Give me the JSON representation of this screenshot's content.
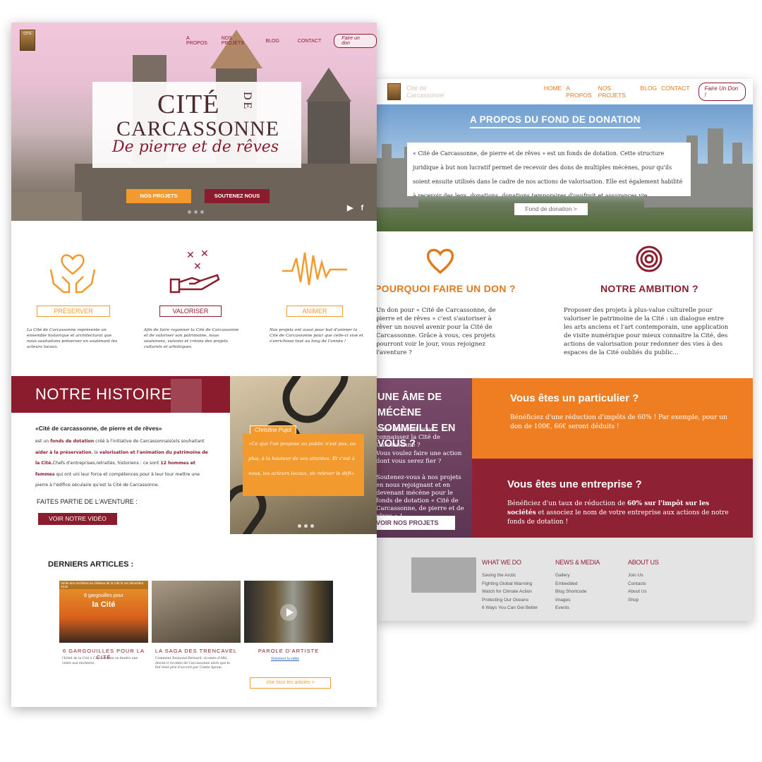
{
  "page1": {
    "nav": {
      "logo_text": "CITÉ",
      "items": [
        "A PROPOS",
        "NOS PROJETS",
        "BLOG",
        "CONTACT"
      ],
      "donate": "Faire un don"
    },
    "hero": {
      "title_cite": "CITÉ",
      "title_de": "DE",
      "title_carcassonne": "CARCASSONNE",
      "tagline": "De pierre et de rêves",
      "btn_projects": "NOS PROJETS",
      "btn_support": "SOUTENEZ NOUS",
      "social_youtube": "▶",
      "social_facebook": "f"
    },
    "pillars": [
      {
        "label": "PRÉSERVER",
        "text": "La Cité de Carcassonne représente un ensemble historique et architectural que nous souhaitons préserver en soutenant les acteurs locaux."
      },
      {
        "label": "VALORISER",
        "text": "Afin de faire rayonner la Cité de Carcassonne et de valoriser son patrimoine, nous soutenons, suivons et créons des projets culturels et artistiques."
      },
      {
        "label": "ANIMER",
        "text": "Nos projets ont aussi pour but d'animer la Cité de Carcassonne pour que celle-ci vive et s'enrichisse tout au long de l'année !"
      }
    ],
    "histoire": {
      "heading": "NOTRE HISTOIRE",
      "title": "«Cité de carcassonne, de pierre et de rêves»",
      "body_1": "est un ",
      "body_b1": "fonds de dotation",
      "body_2": " créé à l'initiative de Carcassonnais(e)s souhaitant ",
      "body_b2": "aider à la préservation",
      "body_3": ", la ",
      "body_b3": "valorisation et l'animation du patrimoine de la Cité.",
      "body_4": "Chefs d'entreprises,retraités, historiens : ce sont ",
      "body_b4": "12 hommes et femmes",
      "body_5": " qui ont uni leur force et compétences pour à leur tour mettre une pierre à l'édifice séculaire qu'est la Cité de Carcassonne.",
      "faites_partie": "FAITES PARTIE DE L'AVENTURE :",
      "video_button": "VOIR NOTRE VIDÉO",
      "quote_author": "Christine Pujol",
      "quote": "«Ce que l'on propose au public n'est pas, ou plus, à la hauteur de ses attentes. Et c'est à nous, les acteurs locaux, de relever le défi»."
    },
    "articles": {
      "heading": "DERNIERS ARTICLES :",
      "items": [
        {
          "title": "6 GARGOUILLES POUR LA CITÉ",
          "caption": "Vente aux enchères au château de la Cité le 1er décembre 2019",
          "overlay_1": "6 gargouilles pour",
          "overlay_2": "la Cité",
          "text": "l'hôtel de la Cité à Carcassonne se fendra une vente aux enchères."
        },
        {
          "title": "LA SAGA DES TRENCAVEL",
          "text": "Comment Raimond-Bernard, vicomte d'Albi, devint-il vicomte de Carcassonne alors que le fief était prié d'accord par Comte Ipsum."
        },
        {
          "title": "PAROLE D'ARTISTE",
          "link": "Visionnez la vidéo"
        }
      ],
      "see_all": "Voir tous les articles  >"
    }
  },
  "page2": {
    "nav": {
      "logo_text": "Cité de Carcassonne",
      "items": [
        "HOME",
        "A PROPOS",
        "NOS PROJETS",
        "BLOG",
        "CONTACT"
      ],
      "donate": "Faire Un Don !"
    },
    "hero": {
      "title": "A PROPOS DU FOND DE DONATION",
      "text": "« Cité de Carcassonne, de pierre et de rêves » est un fonds de dotation. Cette structure juridique à but non lucratif permet de recevoir des dons de multiples mécènes, pour qu'ils soient ensuite utilisés dans le cadre de nos actions de valorisation. Elle est également habilité à recevoir des legs, donations, donations temporaires d'usufruit et assurances vie.",
      "button": "Fond de donation  >"
    },
    "pourquoi": {
      "heading": "POURQUOI FAIRE UN DON ?",
      "text": "Un don pour « Cité de Carcassonne, de pierre et de rêves » c'est s'autoriser à rêver un nouvel avenir pour la Cité de Carcassonne. Grâce à vous, ces projets pourront voir le jour, vous rejoignez l'aventure ?"
    },
    "ambition": {
      "heading": "NOTRE AMBITION ?",
      "text": "Proposer des projets à plus-value culturelle pour valoriser le patrimoine de la Cité : un dialogue entre les arts anciens et l'art contemporain, une application de visite numérique pour mieux connaitre la Cité, des actions de valorisation pour redonner des vies à des espaces de la Cité oubliés du public..."
    },
    "mecene": {
      "heading_1": "UNE ÂME DE MÉCÈNE",
      "heading_2": "SOMMEILLE EN VOUS ?",
      "p1": "Vous aimez et vous connaissez la Cité de Carcassonne ?",
      "p2": "Vous voulez faire une action dont vous serez fier ?",
      "p3": "Soutenez-vous à nos projets en nous rejoignant et en devenant mécène pour le fonds de dotation « Cité de Carcassonne, de pierre et de rêves » !",
      "button": "VOIR NOS PROJETS"
    },
    "particulier": {
      "heading": "Vous êtes un particulier ?",
      "text": "Bénéficiez d'une réduction d'impôts de 60% ! Par exemple, pour un don de 100€, 66€ seront déduits !"
    },
    "entreprise": {
      "heading": "Vous êtes une entreprise ?",
      "text_1": "Bénéficiez d'un taux de réduction de ",
      "text_b1": "60% sur l'impôt sur les sociétés",
      "text_2": " et associez le nom de votre entreprise aux actions de notre fonds de dotation !"
    },
    "footer": {
      "col1": {
        "heading": "WHAT WE DO",
        "items": [
          "Saving the Arctic",
          "Fighting Global Warming",
          "Watch for Climate Action",
          "Protecting Our Oceans",
          "6 Ways You Can Get Better"
        ]
      },
      "col2": {
        "heading": "NEWS & MEDIA",
        "items": [
          "Gallery",
          "Embedded",
          "Blog Shortcode",
          "Images",
          "Events"
        ]
      },
      "col3": {
        "heading": "ABOUT US",
        "items": [
          "Join Us",
          "Contacts",
          "About Us",
          "Shop"
        ]
      }
    }
  },
  "colors": {
    "orange": "#f39a2e",
    "burgundy": "#8a1c2e",
    "plum": "#6a3f5e",
    "deep_orange": "#ef7d22"
  }
}
